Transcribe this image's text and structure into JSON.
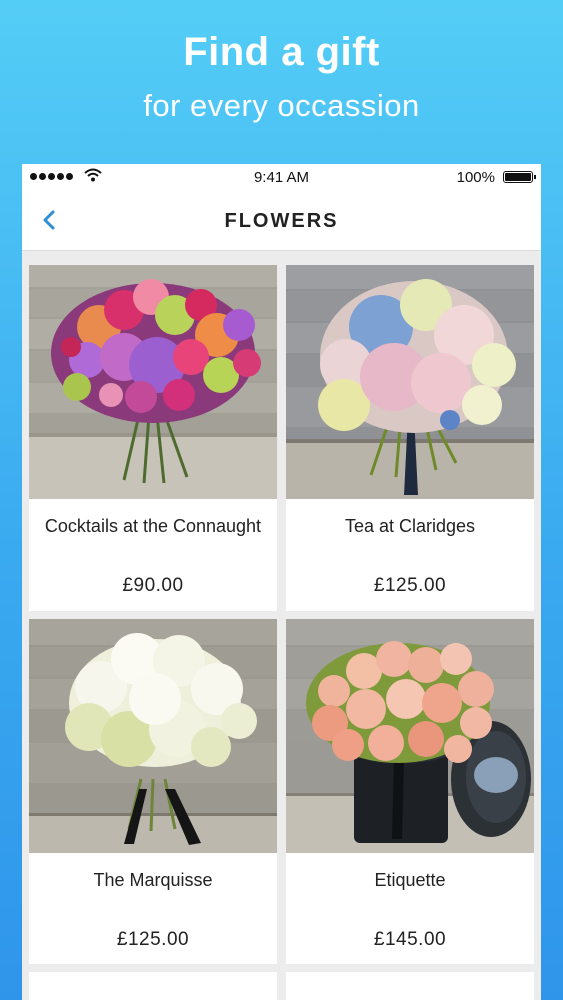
{
  "promo": {
    "title": "Find a gift",
    "subtitle": "for every occassion"
  },
  "status_bar": {
    "time": "9:41 AM",
    "battery": "100%",
    "battery_level": 1.0,
    "icons": [
      "signal-dots-icon",
      "wifi-icon",
      "battery-icon"
    ]
  },
  "nav": {
    "title": "FLOWERS",
    "back_icon": "chevron-left-icon",
    "accent_color": "#2d8fd5"
  },
  "products": [
    {
      "name": "Cocktails at the Connaught",
      "price": "£90.00"
    },
    {
      "name": "Tea at Claridges",
      "price": "£125.00"
    },
    {
      "name": "The Marquisse",
      "price": "£125.00"
    },
    {
      "name": "Etiquette",
      "price": "£145.00"
    }
  ],
  "colors": {
    "background_top": "#54cdf6",
    "background_bottom": "#2f95ea",
    "text": "#222222"
  }
}
